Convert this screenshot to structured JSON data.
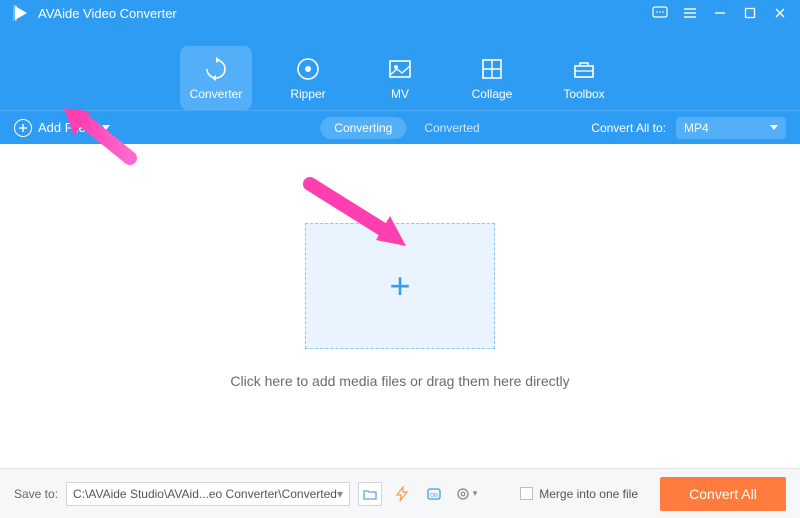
{
  "app": {
    "title": "AVAide Video Converter"
  },
  "tabs": [
    {
      "label": "Converter",
      "icon": "refresh-icon",
      "active": true
    },
    {
      "label": "Ripper",
      "icon": "disc-icon",
      "active": false
    },
    {
      "label": "MV",
      "icon": "image-icon",
      "active": false
    },
    {
      "label": "Collage",
      "icon": "grid-icon",
      "active": false
    },
    {
      "label": "Toolbox",
      "icon": "toolbox-icon",
      "active": false
    }
  ],
  "subbar": {
    "add_files_label": "Add Files",
    "converting_label": "Converting",
    "converted_label": "Converted",
    "convert_all_label": "Convert All to:",
    "selected_format": "MP4"
  },
  "dropzone": {
    "hint": "Click here to add media files or drag them here directly"
  },
  "footer": {
    "save_to_label": "Save to:",
    "path": "C:\\AVAide Studio\\AVAid...eo Converter\\Converted",
    "merge_label": "Merge into one file",
    "convert_button": "Convert All"
  }
}
